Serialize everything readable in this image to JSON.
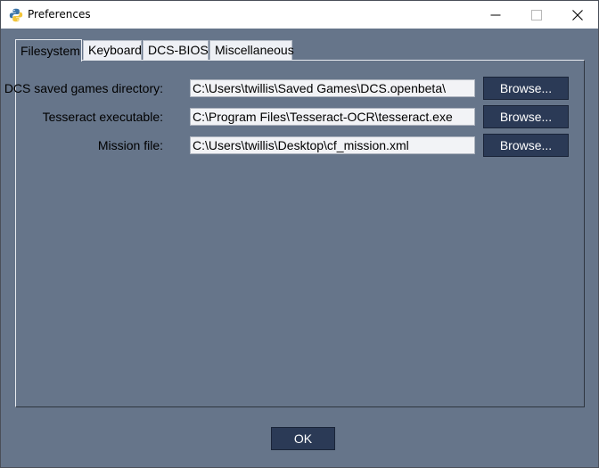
{
  "window": {
    "title": "Preferences",
    "app_icon": "python-icon",
    "controls": [
      "minimize-icon",
      "maximize-icon",
      "close-icon"
    ]
  },
  "tabs": [
    {
      "label": "Filesystem",
      "active": true
    },
    {
      "label": "Keyboard",
      "active": false
    },
    {
      "label": "DCS-BIOS",
      "active": false
    },
    {
      "label": "Miscellaneous",
      "active": false
    }
  ],
  "filesystem": {
    "rows": [
      {
        "label": "DCS saved games directory:",
        "value": "C:\\Users\\twillis\\Saved Games\\DCS.openbeta\\",
        "button": "Browse..."
      },
      {
        "label": "Tesseract executable:",
        "value": "C:\\Program Files\\Tesseract-OCR\\tesseract.exe",
        "button": "Browse..."
      },
      {
        "label": "Mission file:",
        "value": "C:\\Users\\twillis\\Desktop\\cf_mission.xml",
        "button": "Browse..."
      }
    ]
  },
  "footer": {
    "ok_label": "OK"
  },
  "colors": {
    "background": "#66758a",
    "button": "#2b3a56",
    "field": "#f2f3f6",
    "tab_inactive": "#eef0f5"
  }
}
